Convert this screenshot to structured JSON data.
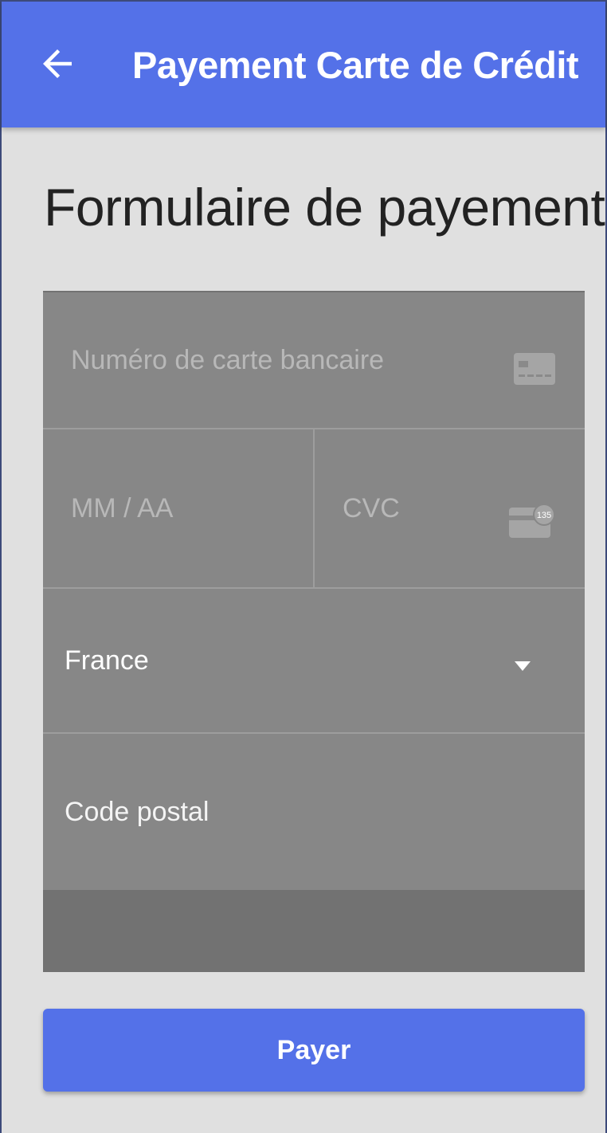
{
  "appbar": {
    "title": "Payement Carte de Crédit",
    "back_icon": "arrow-left-icon",
    "color": "#5471e8"
  },
  "page": {
    "title": "Formulaire de payement"
  },
  "form": {
    "card_number": {
      "placeholder": "Numéro de carte bancaire",
      "icon": "credit-card-icon"
    },
    "expiry": {
      "placeholder": "MM / AA"
    },
    "cvc": {
      "placeholder": "CVC",
      "icon": "cvc-card-icon",
      "icon_badge": "135"
    },
    "country": {
      "value": "France",
      "icon": "caret-down-icon"
    },
    "postal_code": {
      "placeholder": "Code postal"
    }
  },
  "actions": {
    "pay_label": "Payer"
  },
  "colors": {
    "accent": "#5471e8",
    "background": "#e0e0e0",
    "form_field": "#878787"
  }
}
